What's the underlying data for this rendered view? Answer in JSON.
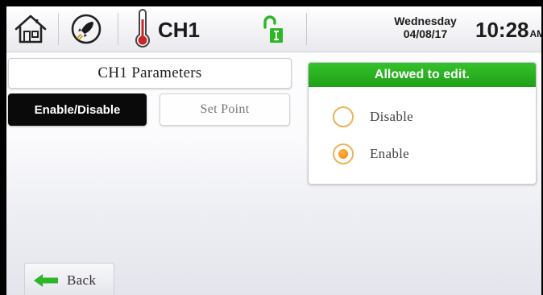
{
  "header": {
    "channel": "CH1",
    "weekday": "Wednesday",
    "date": "04/08/17",
    "time": "10:28",
    "ampm": "AM",
    "icons": [
      "home-icon",
      "rocket-icon",
      "thermometer-icon",
      "unlocked-installer-icon"
    ]
  },
  "left_panel": {
    "title": "CH1 Parameters",
    "tabs": [
      "Enable/Disable",
      "Set Point"
    ],
    "active_tab": "Enable/Disable"
  },
  "right_panel": {
    "status": "Allowed to edit.",
    "options": [
      "Disable",
      "Enable"
    ],
    "selected": "Enable"
  },
  "footer": {
    "back_label": "Back"
  },
  "colors": {
    "accent_green": "#2db726",
    "radio_orange": "#f57c00",
    "thermometer_red": "#c62828",
    "active_tab": "#0a0a0a"
  }
}
